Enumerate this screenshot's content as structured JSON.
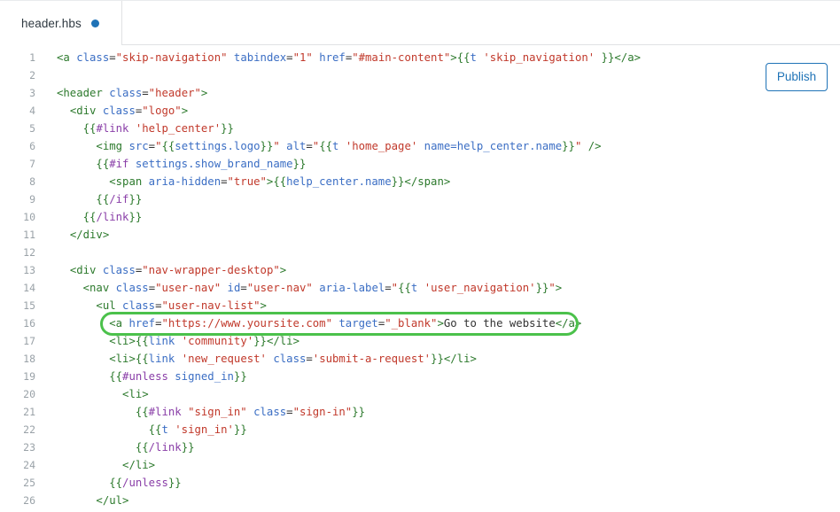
{
  "window": {
    "title": "header.hbs"
  },
  "tabbar": {
    "tabs": [
      {
        "label": "header.hbs",
        "dirty": true,
        "active": true
      }
    ]
  },
  "toolbar": {
    "publish_label": "Publish"
  },
  "editor": {
    "filename": "header.hbs",
    "language": "handlebars",
    "first_visible_line": 1,
    "last_visible_line": 26,
    "highlight": {
      "line": 16,
      "color": "#4bc14b",
      "shape": "rounded-rectangle",
      "text": "<a href=\"https://www.yoursite.com\" target=\"_blank\">Go to the website</a>"
    },
    "colors": {
      "tag": "#2d7a2d",
      "attribute": "#3b6ec4",
      "string": "#c1392b",
      "handlebars_keyword": "#8a3fa8",
      "handlebars_brace": "#2d7a2d",
      "plain": "#333333",
      "line_number": "#9aa2a8",
      "accent": "#1f73b7"
    },
    "lines": [
      {
        "n": "1",
        "tokens": [
          {
            "c": "t-tag",
            "s": "<a "
          },
          {
            "c": "t-attr",
            "s": "class"
          },
          {
            "c": "t-punc",
            "s": "="
          },
          {
            "c": "t-str",
            "s": "\"skip-navigation\""
          },
          {
            "c": "t-plain",
            "s": " "
          },
          {
            "c": "t-attr",
            "s": "tabindex"
          },
          {
            "c": "t-punc",
            "s": "="
          },
          {
            "c": "t-str",
            "s": "\"1\""
          },
          {
            "c": "t-plain",
            "s": " "
          },
          {
            "c": "t-attr",
            "s": "href"
          },
          {
            "c": "t-punc",
            "s": "="
          },
          {
            "c": "t-str",
            "s": "\"#main-content\""
          },
          {
            "c": "t-tag",
            "s": ">"
          },
          {
            "c": "t-hb",
            "s": "{{"
          },
          {
            "c": "t-hbid",
            "s": "t "
          },
          {
            "c": "t-str",
            "s": "'skip_navigation'"
          },
          {
            "c": "t-hb",
            "s": " }}"
          },
          {
            "c": "t-tag",
            "s": "</a>"
          }
        ]
      },
      {
        "n": "2",
        "tokens": []
      },
      {
        "n": "3",
        "tokens": [
          {
            "c": "t-tag",
            "s": "<header "
          },
          {
            "c": "t-attr",
            "s": "class"
          },
          {
            "c": "t-punc",
            "s": "="
          },
          {
            "c": "t-str",
            "s": "\"header\""
          },
          {
            "c": "t-tag",
            "s": ">"
          }
        ]
      },
      {
        "n": "4",
        "tokens": [
          {
            "c": "t-plain",
            "s": "  "
          },
          {
            "c": "t-tag",
            "s": "<div "
          },
          {
            "c": "t-attr",
            "s": "class"
          },
          {
            "c": "t-punc",
            "s": "="
          },
          {
            "c": "t-str",
            "s": "\"logo\""
          },
          {
            "c": "t-tag",
            "s": ">"
          }
        ]
      },
      {
        "n": "5",
        "tokens": [
          {
            "c": "t-plain",
            "s": "    "
          },
          {
            "c": "t-hb",
            "s": "{{"
          },
          {
            "c": "t-hbkw",
            "s": "#link "
          },
          {
            "c": "t-str",
            "s": "'help_center'"
          },
          {
            "c": "t-hb",
            "s": "}}"
          }
        ]
      },
      {
        "n": "6",
        "tokens": [
          {
            "c": "t-plain",
            "s": "      "
          },
          {
            "c": "t-tag",
            "s": "<img "
          },
          {
            "c": "t-attr",
            "s": "src"
          },
          {
            "c": "t-punc",
            "s": "="
          },
          {
            "c": "t-str",
            "s": "\""
          },
          {
            "c": "t-hb",
            "s": "{{"
          },
          {
            "c": "t-hbid",
            "s": "settings.logo"
          },
          {
            "c": "t-hb",
            "s": "}}"
          },
          {
            "c": "t-str",
            "s": "\""
          },
          {
            "c": "t-plain",
            "s": " "
          },
          {
            "c": "t-attr",
            "s": "alt"
          },
          {
            "c": "t-punc",
            "s": "="
          },
          {
            "c": "t-str",
            "s": "\""
          },
          {
            "c": "t-hb",
            "s": "{{"
          },
          {
            "c": "t-hbid",
            "s": "t "
          },
          {
            "c": "t-str",
            "s": "'home_page'"
          },
          {
            "c": "t-plain",
            "s": " "
          },
          {
            "c": "t-hbid",
            "s": "name=help_center.name"
          },
          {
            "c": "t-hb",
            "s": "}}"
          },
          {
            "c": "t-str",
            "s": "\""
          },
          {
            "c": "t-tag",
            "s": " />"
          }
        ]
      },
      {
        "n": "7",
        "tokens": [
          {
            "c": "t-plain",
            "s": "      "
          },
          {
            "c": "t-hb",
            "s": "{{"
          },
          {
            "c": "t-hbkw",
            "s": "#if "
          },
          {
            "c": "t-hbid",
            "s": "settings.show_brand_name"
          },
          {
            "c": "t-hb",
            "s": "}}"
          }
        ]
      },
      {
        "n": "8",
        "tokens": [
          {
            "c": "t-plain",
            "s": "        "
          },
          {
            "c": "t-tag",
            "s": "<span "
          },
          {
            "c": "t-attr",
            "s": "aria-hidden"
          },
          {
            "c": "t-punc",
            "s": "="
          },
          {
            "c": "t-str",
            "s": "\"true\""
          },
          {
            "c": "t-tag",
            "s": ">"
          },
          {
            "c": "t-hb",
            "s": "{{"
          },
          {
            "c": "t-hbid",
            "s": "help_center.name"
          },
          {
            "c": "t-hb",
            "s": "}}"
          },
          {
            "c": "t-tag",
            "s": "</span>"
          }
        ]
      },
      {
        "n": "9",
        "tokens": [
          {
            "c": "t-plain",
            "s": "      "
          },
          {
            "c": "t-hb",
            "s": "{{"
          },
          {
            "c": "t-hbkw",
            "s": "/if"
          },
          {
            "c": "t-hb",
            "s": "}}"
          }
        ]
      },
      {
        "n": "10",
        "tokens": [
          {
            "c": "t-plain",
            "s": "    "
          },
          {
            "c": "t-hb",
            "s": "{{"
          },
          {
            "c": "t-hbkw",
            "s": "/link"
          },
          {
            "c": "t-hb",
            "s": "}}"
          }
        ]
      },
      {
        "n": "11",
        "tokens": [
          {
            "c": "t-plain",
            "s": "  "
          },
          {
            "c": "t-tag",
            "s": "</div>"
          }
        ]
      },
      {
        "n": "12",
        "tokens": []
      },
      {
        "n": "13",
        "tokens": [
          {
            "c": "t-plain",
            "s": "  "
          },
          {
            "c": "t-tag",
            "s": "<div "
          },
          {
            "c": "t-attr",
            "s": "class"
          },
          {
            "c": "t-punc",
            "s": "="
          },
          {
            "c": "t-str",
            "s": "\"nav-wrapper-desktop\""
          },
          {
            "c": "t-tag",
            "s": ">"
          }
        ]
      },
      {
        "n": "14",
        "tokens": [
          {
            "c": "t-plain",
            "s": "    "
          },
          {
            "c": "t-tag",
            "s": "<nav "
          },
          {
            "c": "t-attr",
            "s": "class"
          },
          {
            "c": "t-punc",
            "s": "="
          },
          {
            "c": "t-str",
            "s": "\"user-nav\""
          },
          {
            "c": "t-plain",
            "s": " "
          },
          {
            "c": "t-attr",
            "s": "id"
          },
          {
            "c": "t-punc",
            "s": "="
          },
          {
            "c": "t-str",
            "s": "\"user-nav\""
          },
          {
            "c": "t-plain",
            "s": " "
          },
          {
            "c": "t-attr",
            "s": "aria-label"
          },
          {
            "c": "t-punc",
            "s": "="
          },
          {
            "c": "t-str",
            "s": "\""
          },
          {
            "c": "t-hb",
            "s": "{{"
          },
          {
            "c": "t-hbid",
            "s": "t "
          },
          {
            "c": "t-str",
            "s": "'user_navigation'"
          },
          {
            "c": "t-hb",
            "s": "}}"
          },
          {
            "c": "t-str",
            "s": "\""
          },
          {
            "c": "t-tag",
            "s": ">"
          }
        ]
      },
      {
        "n": "15",
        "tokens": [
          {
            "c": "t-plain",
            "s": "      "
          },
          {
            "c": "t-tag",
            "s": "<ul "
          },
          {
            "c": "t-attr",
            "s": "class"
          },
          {
            "c": "t-punc",
            "s": "="
          },
          {
            "c": "t-str",
            "s": "\"user-nav-list\""
          },
          {
            "c": "t-tag",
            "s": ">"
          }
        ]
      },
      {
        "n": "16",
        "tokens": [
          {
            "c": "t-plain",
            "s": "        "
          },
          {
            "c": "t-tag",
            "s": "<a "
          },
          {
            "c": "t-attr",
            "s": "href"
          },
          {
            "c": "t-punc",
            "s": "="
          },
          {
            "c": "t-str",
            "s": "\"https://www.yoursite.com\""
          },
          {
            "c": "t-plain",
            "s": " "
          },
          {
            "c": "t-attr",
            "s": "target"
          },
          {
            "c": "t-punc",
            "s": "="
          },
          {
            "c": "t-str",
            "s": "\"_blank\""
          },
          {
            "c": "t-tag",
            "s": ">"
          },
          {
            "c": "t-plain",
            "s": "Go to the website"
          },
          {
            "c": "t-tag",
            "s": "</a>"
          }
        ]
      },
      {
        "n": "17",
        "tokens": [
          {
            "c": "t-plain",
            "s": "        "
          },
          {
            "c": "t-tag",
            "s": "<li>"
          },
          {
            "c": "t-hb",
            "s": "{{"
          },
          {
            "c": "t-hbid",
            "s": "link "
          },
          {
            "c": "t-str",
            "s": "'community'"
          },
          {
            "c": "t-hb",
            "s": "}}"
          },
          {
            "c": "t-tag",
            "s": "</li>"
          }
        ]
      },
      {
        "n": "18",
        "tokens": [
          {
            "c": "t-plain",
            "s": "        "
          },
          {
            "c": "t-tag",
            "s": "<li>"
          },
          {
            "c": "t-hb",
            "s": "{{"
          },
          {
            "c": "t-hbid",
            "s": "link "
          },
          {
            "c": "t-str",
            "s": "'new_request'"
          },
          {
            "c": "t-plain",
            "s": " "
          },
          {
            "c": "t-attr",
            "s": "class"
          },
          {
            "c": "t-punc",
            "s": "="
          },
          {
            "c": "t-str",
            "s": "'submit-a-request'"
          },
          {
            "c": "t-hb",
            "s": "}}"
          },
          {
            "c": "t-tag",
            "s": "</li>"
          }
        ]
      },
      {
        "n": "19",
        "tokens": [
          {
            "c": "t-plain",
            "s": "        "
          },
          {
            "c": "t-hb",
            "s": "{{"
          },
          {
            "c": "t-hbkw",
            "s": "#unless "
          },
          {
            "c": "t-hbid",
            "s": "signed_in"
          },
          {
            "c": "t-hb",
            "s": "}}"
          }
        ]
      },
      {
        "n": "20",
        "tokens": [
          {
            "c": "t-plain",
            "s": "          "
          },
          {
            "c": "t-tag",
            "s": "<li>"
          }
        ]
      },
      {
        "n": "21",
        "tokens": [
          {
            "c": "t-plain",
            "s": "            "
          },
          {
            "c": "t-hb",
            "s": "{{"
          },
          {
            "c": "t-hbkw",
            "s": "#link "
          },
          {
            "c": "t-str",
            "s": "\"sign_in\""
          },
          {
            "c": "t-plain",
            "s": " "
          },
          {
            "c": "t-attr",
            "s": "class"
          },
          {
            "c": "t-punc",
            "s": "="
          },
          {
            "c": "t-str",
            "s": "\"sign-in\""
          },
          {
            "c": "t-hb",
            "s": "}}"
          }
        ]
      },
      {
        "n": "22",
        "tokens": [
          {
            "c": "t-plain",
            "s": "              "
          },
          {
            "c": "t-hb",
            "s": "{{"
          },
          {
            "c": "t-hbid",
            "s": "t "
          },
          {
            "c": "t-str",
            "s": "'sign_in'"
          },
          {
            "c": "t-hb",
            "s": "}}"
          }
        ]
      },
      {
        "n": "23",
        "tokens": [
          {
            "c": "t-plain",
            "s": "            "
          },
          {
            "c": "t-hb",
            "s": "{{"
          },
          {
            "c": "t-hbkw",
            "s": "/link"
          },
          {
            "c": "t-hb",
            "s": "}}"
          }
        ]
      },
      {
        "n": "24",
        "tokens": [
          {
            "c": "t-plain",
            "s": "          "
          },
          {
            "c": "t-tag",
            "s": "</li>"
          }
        ]
      },
      {
        "n": "25",
        "tokens": [
          {
            "c": "t-plain",
            "s": "        "
          },
          {
            "c": "t-hb",
            "s": "{{"
          },
          {
            "c": "t-hbkw",
            "s": "/unless"
          },
          {
            "c": "t-hb",
            "s": "}}"
          }
        ]
      },
      {
        "n": "26",
        "tokens": [
          {
            "c": "t-plain",
            "s": "      "
          },
          {
            "c": "t-tag",
            "s": "</ul>"
          }
        ]
      }
    ]
  }
}
